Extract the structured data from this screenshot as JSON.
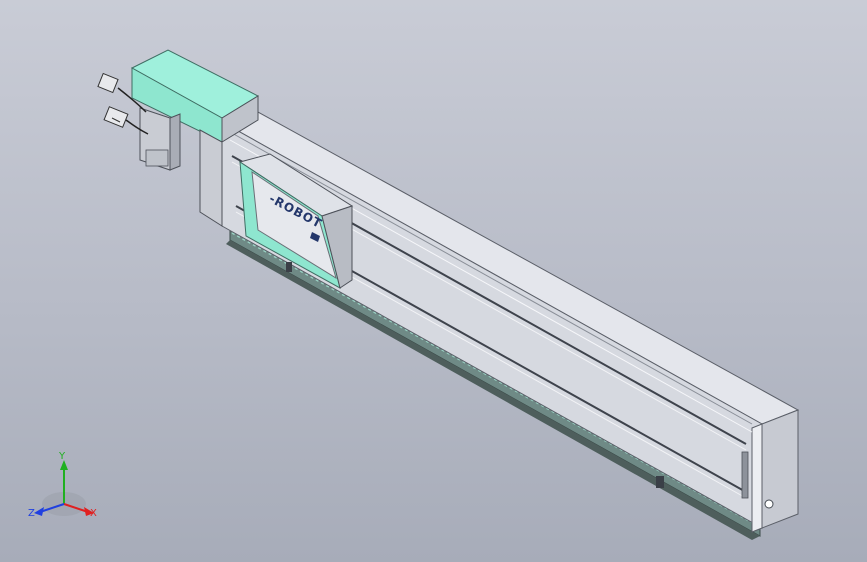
{
  "viewport": {
    "background_top": "#c9ccd6",
    "background_bottom": "#a7acb9"
  },
  "model": {
    "logo_text": "-ROBOT",
    "accent_color": "#8ee6cf",
    "body_color": "#d8dbe2"
  },
  "triad": {
    "x_label": "X",
    "y_label": "Y",
    "z_label": "Z",
    "x_color": "#e02020",
    "y_color": "#20b020",
    "z_color": "#2040e0"
  }
}
